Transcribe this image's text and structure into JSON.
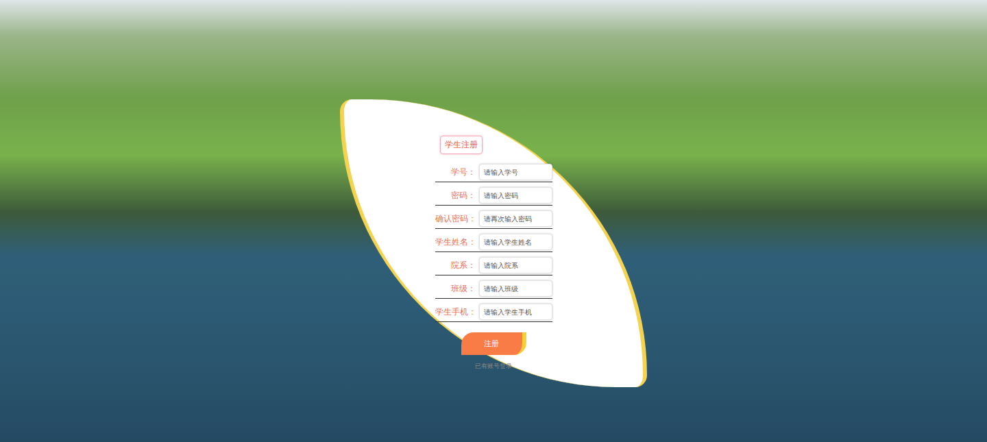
{
  "page": {
    "title": "学生注册"
  },
  "fields": [
    {
      "label": "学号：",
      "placeholder": "请输入学号"
    },
    {
      "label": "密码：",
      "placeholder": "请输入密码"
    },
    {
      "label": "确认密码：",
      "placeholder": "请再次输入密码"
    },
    {
      "label": "学生姓名：",
      "placeholder": "请输入学生姓名"
    },
    {
      "label": "院系：",
      "placeholder": "请输入院系"
    },
    {
      "label": "班级：",
      "placeholder": "请输入班级"
    },
    {
      "label": "学生手机：",
      "placeholder": "请输入学生手机"
    }
  ],
  "submit": {
    "label": "注册"
  },
  "link": {
    "label": "已有账号登录"
  }
}
